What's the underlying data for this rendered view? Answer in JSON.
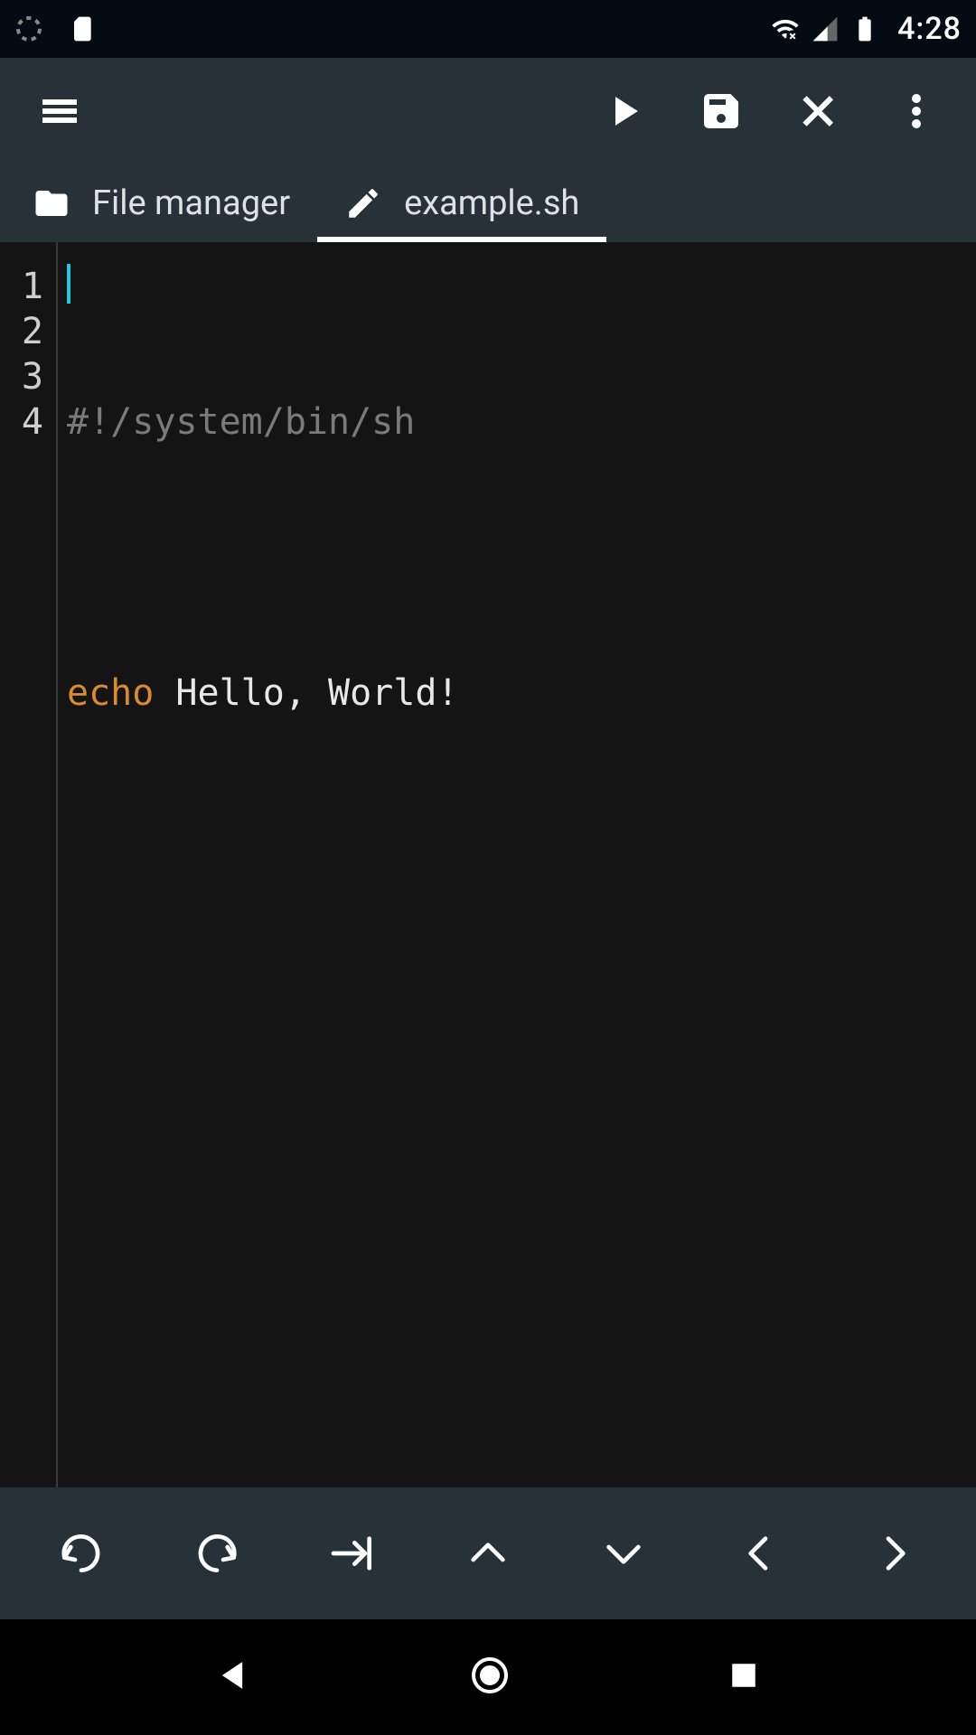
{
  "status": {
    "time": "4:28"
  },
  "tabs": {
    "file_manager": "File manager",
    "editor_file": "example.sh"
  },
  "code": {
    "lines": [
      "#!/system/bin/sh",
      "",
      "echo Hello, World!",
      ""
    ],
    "shebang": "#!/system/bin/sh",
    "kw_echo": "echo",
    "echo_rest": " Hello, World!"
  },
  "gutter": {
    "n1": "1",
    "n2": "2",
    "n3": "3",
    "n4": "4"
  }
}
